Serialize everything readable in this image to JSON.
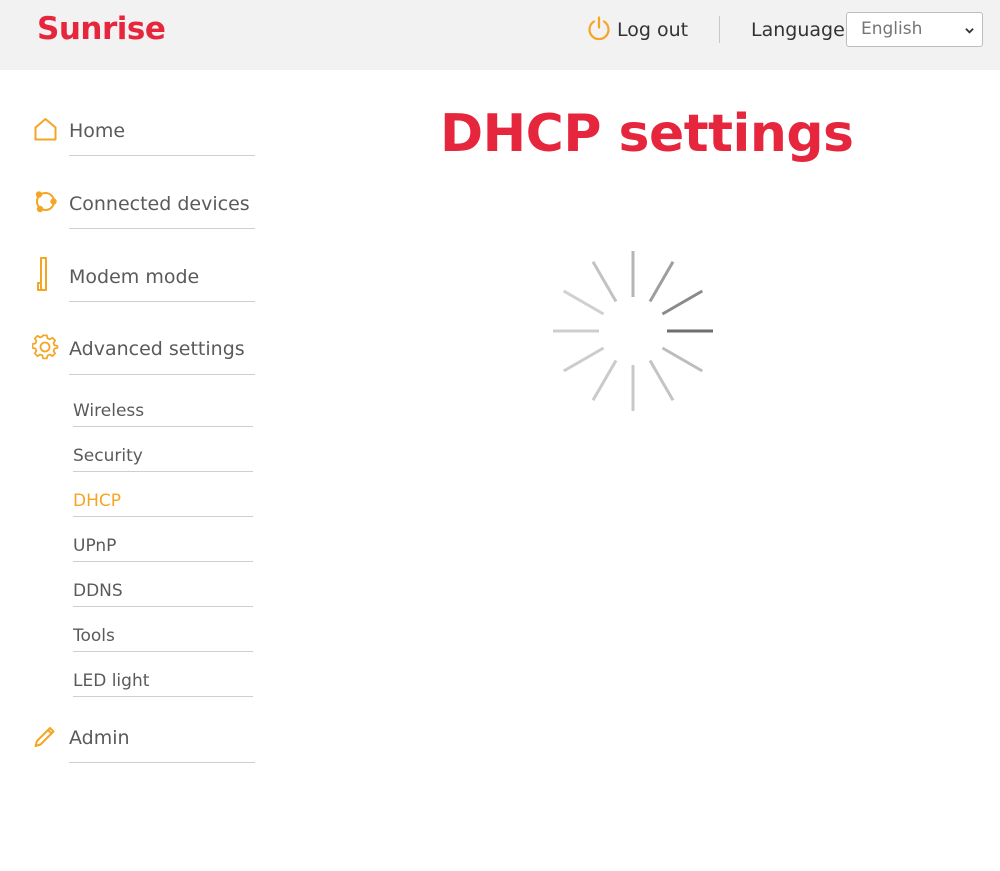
{
  "header": {
    "logo_text": "Sunrise",
    "logout_label": "Log out",
    "language_label": "Language",
    "language_selected": "English",
    "accent_color": "#e6263d",
    "icon_color": "#f5a524"
  },
  "sidebar": {
    "items": [
      {
        "label": "Home",
        "icon": "home-icon"
      },
      {
        "label": "Connected devices",
        "icon": "connected-devices-icon"
      },
      {
        "label": "Modem mode",
        "icon": "modem-icon"
      },
      {
        "label": "Advanced settings",
        "icon": "gear-icon"
      },
      {
        "label": "Admin",
        "icon": "pencil-icon"
      }
    ],
    "subitems": [
      {
        "label": "Wireless"
      },
      {
        "label": "Security"
      },
      {
        "label": "DHCP",
        "active": true
      },
      {
        "label": "UPnP"
      },
      {
        "label": "DDNS"
      },
      {
        "label": "Tools"
      },
      {
        "label": "LED light"
      }
    ]
  },
  "main": {
    "title": "DHCP settings",
    "loading_icon": "spinner-icon"
  }
}
